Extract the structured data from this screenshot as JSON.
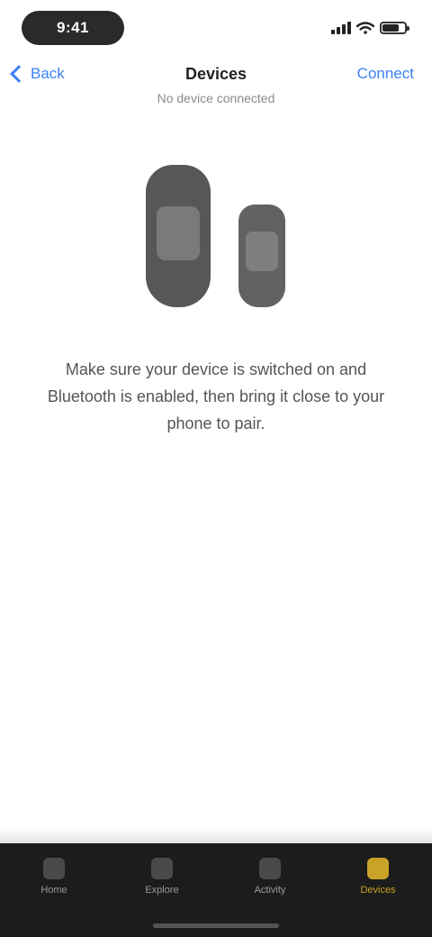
{
  "status_bar": {
    "time": "9:41",
    "signal_icon": "signal-icon",
    "wifi_icon": "wifi-icon",
    "battery_icon": "battery-icon"
  },
  "nav": {
    "back_label": "Back",
    "title": "Devices",
    "subtitle": "No device connected",
    "action_label": "Connect"
  },
  "hero": {
    "device_large_label": "",
    "device_small_label": ""
  },
  "description": "Make sure your device is switched on and Bluetooth is enabled, then bring it close to your phone to pair.",
  "tabs": [
    {
      "label": "Home",
      "icon": "home-icon"
    },
    {
      "label": "Explore",
      "icon": "explore-icon"
    },
    {
      "label": "Activity",
      "icon": "activity-icon"
    },
    {
      "label": "Devices",
      "icon": "devices-icon"
    }
  ],
  "colors": {
    "accent": "#3b82f6",
    "tab_active": "#c9a227",
    "tab_bar_bg": "#1c1c1c"
  }
}
